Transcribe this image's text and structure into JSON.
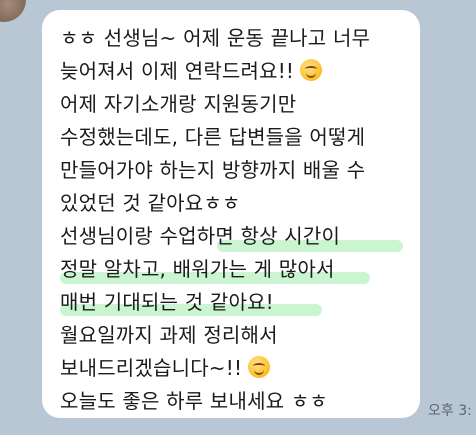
{
  "message": {
    "lines": [
      "ㅎㅎ 선생님~ 어제 운동 끝나고 너무",
      "늦어져서 이제 연락드려요!!",
      "어제 자기소개랑 지원동기만",
      "수정했는데도, 다른 답변들을 어떻게",
      "만들어가야 하는지 방향까지 배울 수",
      "있었던 것 같아요ㅎㅎ",
      "선생님이랑 수업하면 항상 시간이",
      "정말 알차고, 배워가는 게 많아서",
      "매번 기대되는 것 같아요!",
      "월요일까지 과제 정리해서",
      "보내드리겠습니다~!!",
      "오늘도 좋은 하루 보내세요 ㅎㅎ"
    ]
  },
  "timestamp": "오후 3:",
  "colors": {
    "background": "#b9c6d3",
    "bubble": "#ffffff",
    "highlight": "#b9f0c2"
  },
  "icons": {
    "emoji_1": "smiling-face-icon",
    "emoji_2": "smiling-face-icon"
  }
}
